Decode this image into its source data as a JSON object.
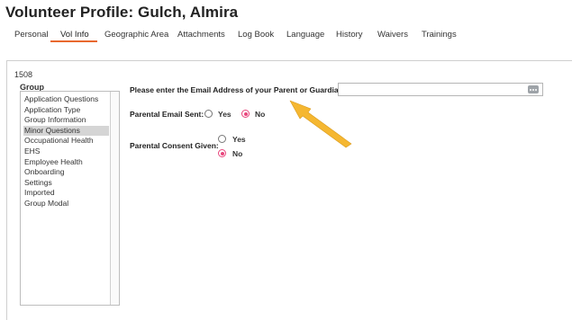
{
  "page": {
    "title": "Volunteer Profile: Gulch, Almira",
    "record_id": "1508",
    "accent_color": "#e8682e",
    "radio_color": "#e8467c",
    "arrow_color": "#f5b731"
  },
  "tabs": [
    {
      "label": "Personal",
      "active": false
    },
    {
      "label": "Vol Info",
      "active": true
    },
    {
      "label": "Geographic Area",
      "active": false
    },
    {
      "label": "Attachments",
      "active": false
    },
    {
      "label": "Log Book",
      "active": false
    },
    {
      "label": "Language",
      "active": false
    },
    {
      "label": "History",
      "active": false
    },
    {
      "label": "Waivers",
      "active": false
    },
    {
      "label": "Trainings",
      "active": false
    }
  ],
  "group": {
    "label": "Group",
    "items": [
      {
        "label": "Application Questions",
        "selected": false
      },
      {
        "label": "Application Type",
        "selected": false
      },
      {
        "label": "Group Information",
        "selected": false
      },
      {
        "label": "Minor Questions",
        "selected": true
      },
      {
        "label": "Occupational Health",
        "selected": false
      },
      {
        "label": "EHS",
        "selected": false
      },
      {
        "label": "Employee Health",
        "selected": false
      },
      {
        "label": "Onboarding",
        "selected": false
      },
      {
        "label": "Settings",
        "selected": false
      },
      {
        "label": "Imported",
        "selected": false
      },
      {
        "label": "Group Modal",
        "selected": false
      }
    ]
  },
  "form": {
    "email_label": "Please enter the Email Address of your Parent or Guardian:",
    "email_value": "",
    "email_button_icon": "ellipsis-icon",
    "parental_email_label": "Parental Email Sent:",
    "parental_email_options": [
      "Yes",
      "No"
    ],
    "parental_email_selected": "No",
    "consent_label": "Parental Consent Given:",
    "consent_options": [
      "Yes",
      "No"
    ],
    "consent_selected": "No"
  },
  "annotation": {
    "icon": "arrow-icon"
  }
}
